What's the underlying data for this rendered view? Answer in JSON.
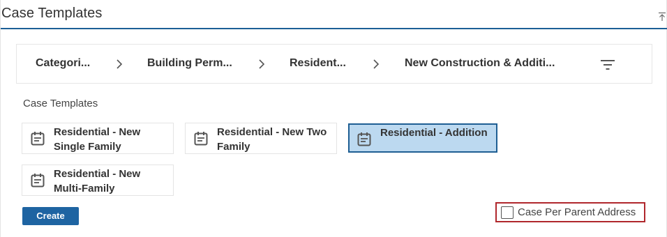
{
  "header": {
    "title": "Case Templates",
    "collapse_icon": "collapse-up-icon"
  },
  "breadcrumb": {
    "items": [
      {
        "label": "Categori..."
      },
      {
        "label": "Building Perm..."
      },
      {
        "label": "Resident..."
      },
      {
        "label": "New Construction & Additi..."
      }
    ],
    "separator_icon": "chevron-right-icon",
    "filter_icon": "filter-icon"
  },
  "templates": {
    "section_label": "Case Templates",
    "items": [
      {
        "label": "Residential - New Single Family",
        "icon": "calendar-icon",
        "selected": false
      },
      {
        "label": "Residential - New Two Family",
        "icon": "calendar-icon",
        "selected": false
      },
      {
        "label": "Residential - Addition",
        "icon": "calendar-icon",
        "selected": true
      },
      {
        "label": "Residential - New Multi-Family",
        "icon": "calendar-icon",
        "selected": false
      }
    ]
  },
  "actions": {
    "create_label": "Create"
  },
  "options": {
    "case_per_parent_label": "Case Per Parent Address",
    "case_per_parent_checked": false
  },
  "colors": {
    "accent": "#1e64a2",
    "selected_bg": "#bcd9f0",
    "highlight_border": "#b0272c"
  }
}
